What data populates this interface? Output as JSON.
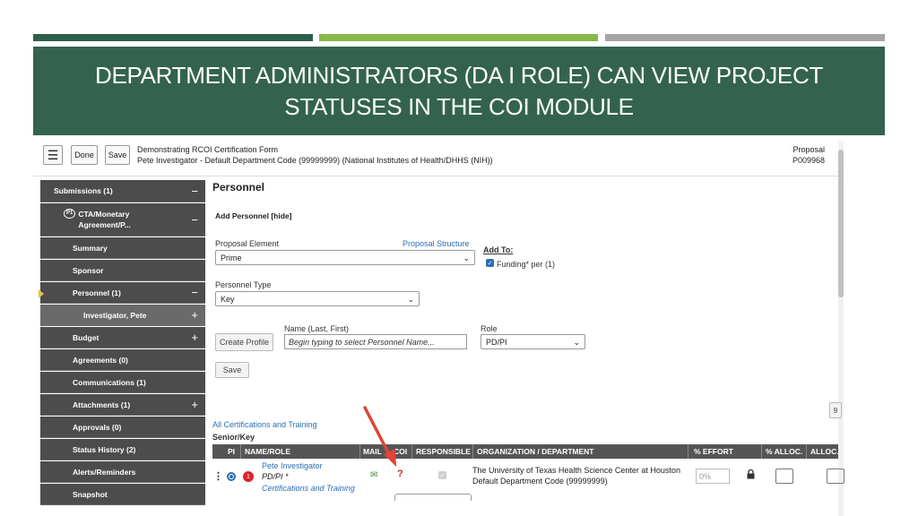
{
  "slide": {
    "title": "DEPARTMENT ADMINISTRATORS (DA I ROLE) CAN VIEW PROJECT STATUSES IN THE COI MODULE",
    "bar_colors": [
      "#2f5e4b",
      "#86b84a",
      "#a5a5a5"
    ],
    "banner_color": "#33634f"
  },
  "header": {
    "menu_icon": "☰",
    "done_label": "Done",
    "save_label": "Save",
    "form_title": "Demonstrating RCOI Certification Form",
    "form_subtitle": "Pete Investigator - Default Department Code (99999999) (National Institutes of Health/DHHS (NIH))",
    "proposal_label": "Proposal",
    "proposal_number": "P009968"
  },
  "sidebar": {
    "items": [
      {
        "label": "Submissions (1)",
        "pm": "−"
      },
      {
        "label": "CTA/Monetary Agreement/P...",
        "pm": "−",
        "badge": "P1"
      },
      {
        "label": "Summary",
        "pm": ""
      },
      {
        "label": "Sponsor",
        "pm": ""
      },
      {
        "label": "Personnel (1)",
        "pm": "−"
      },
      {
        "label": "Investigator, Pete",
        "pm": "+"
      },
      {
        "label": "Budget",
        "pm": "+"
      },
      {
        "label": "Agreements (0)",
        "pm": ""
      },
      {
        "label": "Communications (1)",
        "pm": ""
      },
      {
        "label": "Attachments (1)",
        "pm": "+"
      },
      {
        "label": "Approvals (0)",
        "pm": ""
      },
      {
        "label": "Status History (2)",
        "pm": ""
      },
      {
        "label": "Alerts/Reminders",
        "pm": ""
      },
      {
        "label": "Snapshot",
        "pm": ""
      }
    ]
  },
  "main": {
    "heading": "Personnel",
    "add_personnel": "Add Personnel [hide]",
    "proposal_element_label": "Proposal Element",
    "proposal_structure_link": "Proposal Structure",
    "proposal_element_value": "Prime",
    "add_to_label": "Add To:",
    "funding_label": "Funding* per (1)",
    "personnel_type_label": "Personnel Type",
    "personnel_type_value": "Key",
    "name_label": "Name (Last, First)",
    "name_placeholder": "Begin typing to select Personnel Name...",
    "role_label": "Role",
    "role_value": "PD/PI",
    "create_profile_label": "Create Profile",
    "save_label": "Save",
    "certs_link": "All Certifications and Training",
    "senior_key_label": "Senior/Key",
    "right_partial": "9"
  },
  "table": {
    "headers": [
      "PI",
      "NAME/ROLE",
      "MAIL",
      "COI",
      "RESPONSIBLE",
      "ORGANIZATION / DEPARTMENT",
      "% EFFORT",
      "% ALLOC.",
      "ALLOC."
    ],
    "row": {
      "badge": "1",
      "name": "Pete Investigator",
      "role": "PD/PI *",
      "certs": "Certifications and Training",
      "org": "The University of Texas Health Science Center at Houston",
      "dept": "Default Department Code (99999999)",
      "effort": "0%",
      "mail_icon": "✉",
      "coi_icon": "?",
      "lock_icon": "🔒"
    }
  },
  "annotation": {
    "arrow_color": "#e0443a"
  }
}
